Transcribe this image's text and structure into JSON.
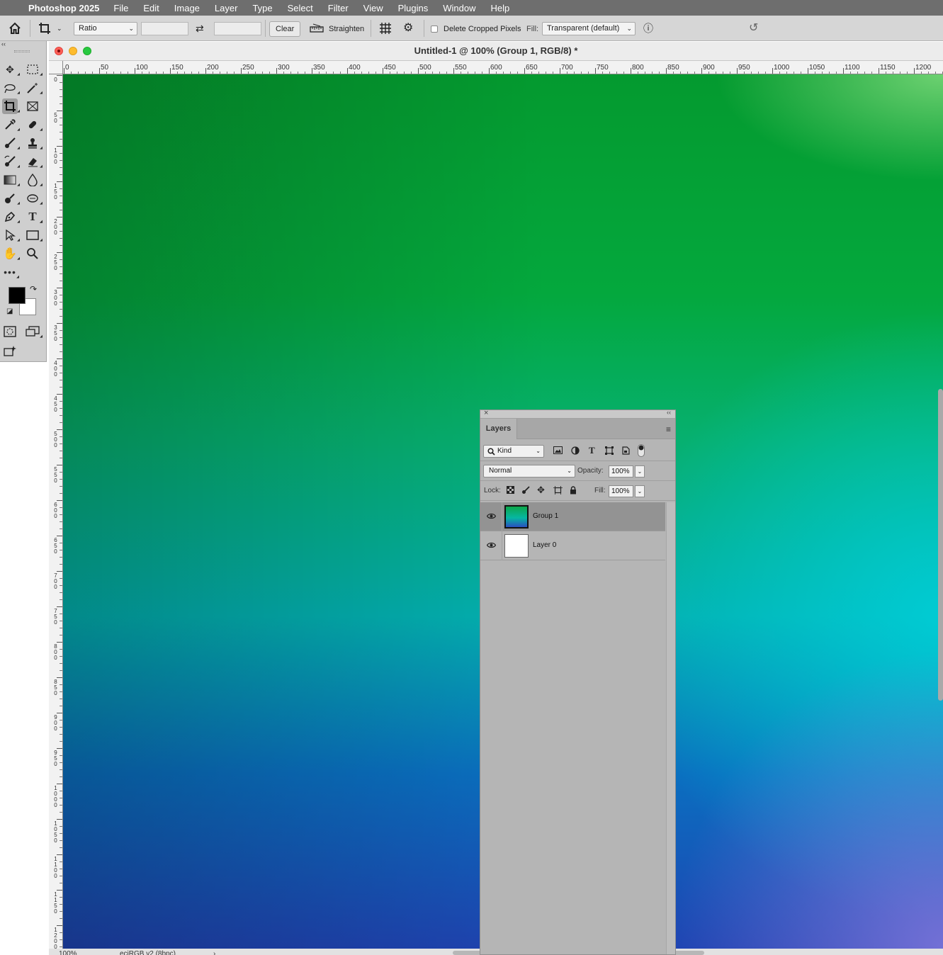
{
  "menubar": {
    "apple_icon": "apple-icon",
    "app_name": "Photoshop 2025",
    "items": [
      "File",
      "Edit",
      "Image",
      "Layer",
      "Type",
      "Select",
      "Filter",
      "View",
      "Plugins",
      "Window",
      "Help"
    ]
  },
  "options_bar": {
    "home_icon": "home-icon",
    "crop_tool_icon": "crop-icon",
    "ratio_select": "Ratio",
    "swap_icon": "swap-arrows-icon",
    "clear_label": "Clear",
    "straighten_label": "Straighten",
    "grid_overlay_icon": "grid-icon",
    "settings_icon": "gear-icon",
    "delete_cropped_label": "Delete Cropped Pixels",
    "delete_cropped_checked": false,
    "fill_label": "Fill:",
    "fill_select": "Transparent (default)",
    "info_icon": "info-icon",
    "reset_icon": "reset-icon"
  },
  "document": {
    "title": "Untitled-1 @ 100% (Group 1, RGB/8) *",
    "zoom": "100%",
    "profile": "eciRGB v2 (8bpc)",
    "status_arrow": "›",
    "ruler_h_labels": [
      "0",
      "50",
      "100",
      "150",
      "200",
      "250",
      "300",
      "350",
      "400",
      "450",
      "500",
      "550",
      "600",
      "650",
      "700",
      "750",
      "800",
      "850",
      "900",
      "950",
      "1000",
      "1050",
      "1100",
      "1150",
      "1200"
    ],
    "ruler_v_labels": [
      "0",
      "5\n0",
      "1\n0\n0",
      "1\n5\n0",
      "2\n0\n0",
      "2\n5\n0",
      "3\n0\n0",
      "3\n5\n0",
      "4\n0\n0",
      "4\n5\n0",
      "5\n0\n0",
      "5\n5\n0",
      "6\n0\n0",
      "6\n5\n0",
      "7\n0\n0",
      "7\n5\n0",
      "8\n0\n0",
      "8\n5\n0",
      "9\n0\n0",
      "9\n5\n0",
      "1\n0\n0\n0",
      "1\n0\n5\n0",
      "1\n1\n0\n0",
      "1\n1\n5\n0",
      "1\n2\n0\n0"
    ]
  },
  "layers_panel": {
    "tab_label": "Layers",
    "filter_select": "Kind",
    "blend_mode": "Normal",
    "opacity_label": "Opacity:",
    "opacity_value": "100%",
    "lock_label": "Lock:",
    "fill_label": "Fill:",
    "fill_value": "100%",
    "layers": [
      {
        "name": "Group 1",
        "visible": true,
        "selected": true
      },
      {
        "name": "Layer 0",
        "visible": true,
        "selected": false
      }
    ]
  },
  "colors": {
    "foreground": "#000000",
    "background": "#ffffff"
  }
}
